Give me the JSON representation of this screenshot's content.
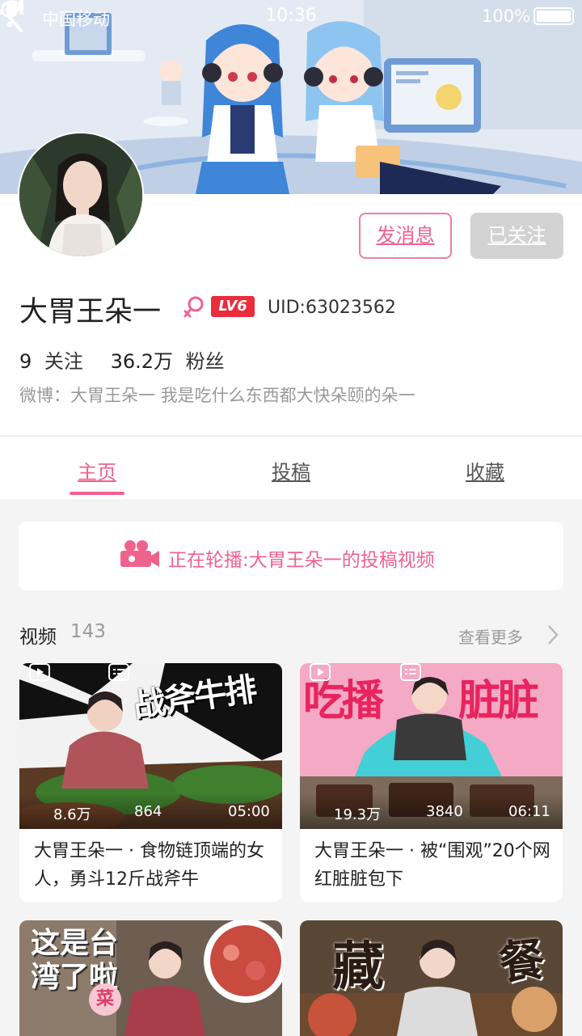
{
  "status_bar": {
    "carrier": "中国移动",
    "time": "10:36",
    "battery": "100%"
  },
  "banner": {
    "icons": [
      "back-arrow-icon",
      "more-vertical-icon"
    ]
  },
  "profile": {
    "username": "大胃王朵一",
    "gender": "female",
    "level": "LV6",
    "uid": "UID:63023562",
    "following_count": "9",
    "following_label": "关注",
    "followers_count": "36.2万",
    "followers_label": "粉丝",
    "bio": "微博：大胃王朵一 我是吃什么东西都大快朵颐的朵一",
    "message_button": "发消息",
    "follow_button": "已关注"
  },
  "tabs": [
    {
      "label": "主页",
      "active": true
    },
    {
      "label": "投稿",
      "active": false
    },
    {
      "label": "收藏",
      "active": false
    }
  ],
  "now_playing": {
    "text": "正在轮播:大胃王朵一的投稿视频"
  },
  "videos_section": {
    "title": "视频",
    "count": "143",
    "see_more": "查看更多"
  },
  "videos": [
    {
      "thumb_text": "战斧牛排",
      "views": "8.6万",
      "danmaku": "864",
      "duration": "05:00",
      "title": "大胃王朵一 · 食物链顶端的女人，勇斗12斤战斧牛"
    },
    {
      "thumb_text_left": "吃播",
      "thumb_text_right": "脏脏",
      "views": "19.3万",
      "danmaku": "3840",
      "duration": "06:11",
      "title": "大胃王朵一 · 被“围观”20个网红脏脏包下"
    },
    {
      "thumb_text": "这是台湾了啦",
      "thumb_badge": "菜"
    },
    {
      "thumb_text_left": "藏",
      "thumb_text_right": "餐"
    }
  ],
  "colors": {
    "accent_pink": "#f0628e",
    "level_red": "#ea2c3c",
    "muted_gray": "#999999",
    "followed_gray": "#d2d2d2"
  }
}
